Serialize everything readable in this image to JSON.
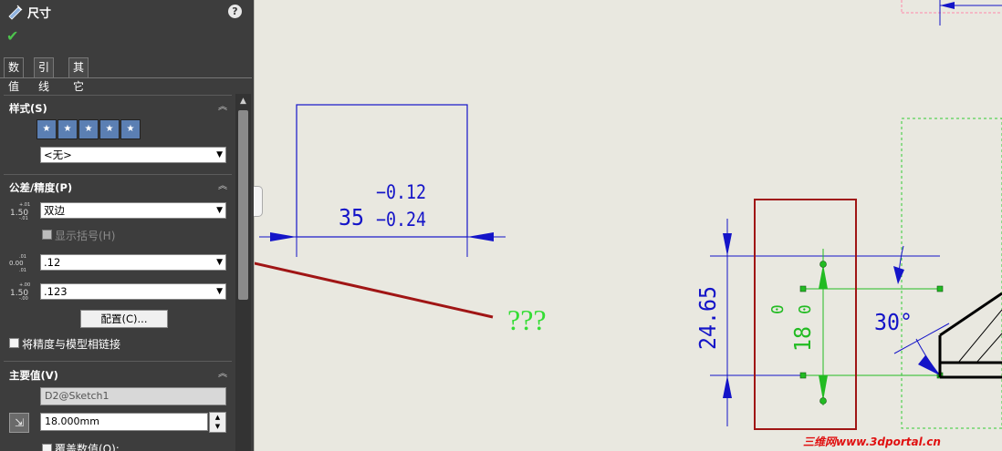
{
  "panel": {
    "title": "尺寸",
    "help": "?",
    "tabs": [
      "数值",
      "引线",
      "其它"
    ],
    "style_section": {
      "title": "样式(S)",
      "select_value": "<无>"
    },
    "tolerance_section": {
      "title": "公差/精度(P)",
      "tolerance_type": "双边",
      "show_parentheses": "显示括号(H)",
      "primary_precision": ".12",
      "tolerance_precision": ".123",
      "config_button": "配置(C)...",
      "link_precision": "将精度与模型相链接"
    },
    "primary_value_section": {
      "title": "主要值(V)",
      "name": "D2@Sketch1",
      "value": "18.000mm",
      "override": "覆盖数值(O):"
    }
  },
  "drawing": {
    "dim_box": {
      "nominal": "35",
      "upper_tol": "−0.12",
      "lower_tol": "−0.24"
    },
    "question": "???",
    "vertical_dim": "24.65",
    "selected_dim": {
      "nominal": "18",
      "upper_tol": "0",
      "lower_tol": "0"
    },
    "angle_dim": "30°"
  },
  "colors": {
    "panel_bg": "#3d3d3d",
    "canvas_bg": "#e9e8e0",
    "dimension_blue": "#1414c8",
    "selected_green": "#22bb22",
    "annotation_red": "#a01515",
    "question_green": "#33dd33"
  },
  "watermark": "三维网www.3dportal.cn"
}
